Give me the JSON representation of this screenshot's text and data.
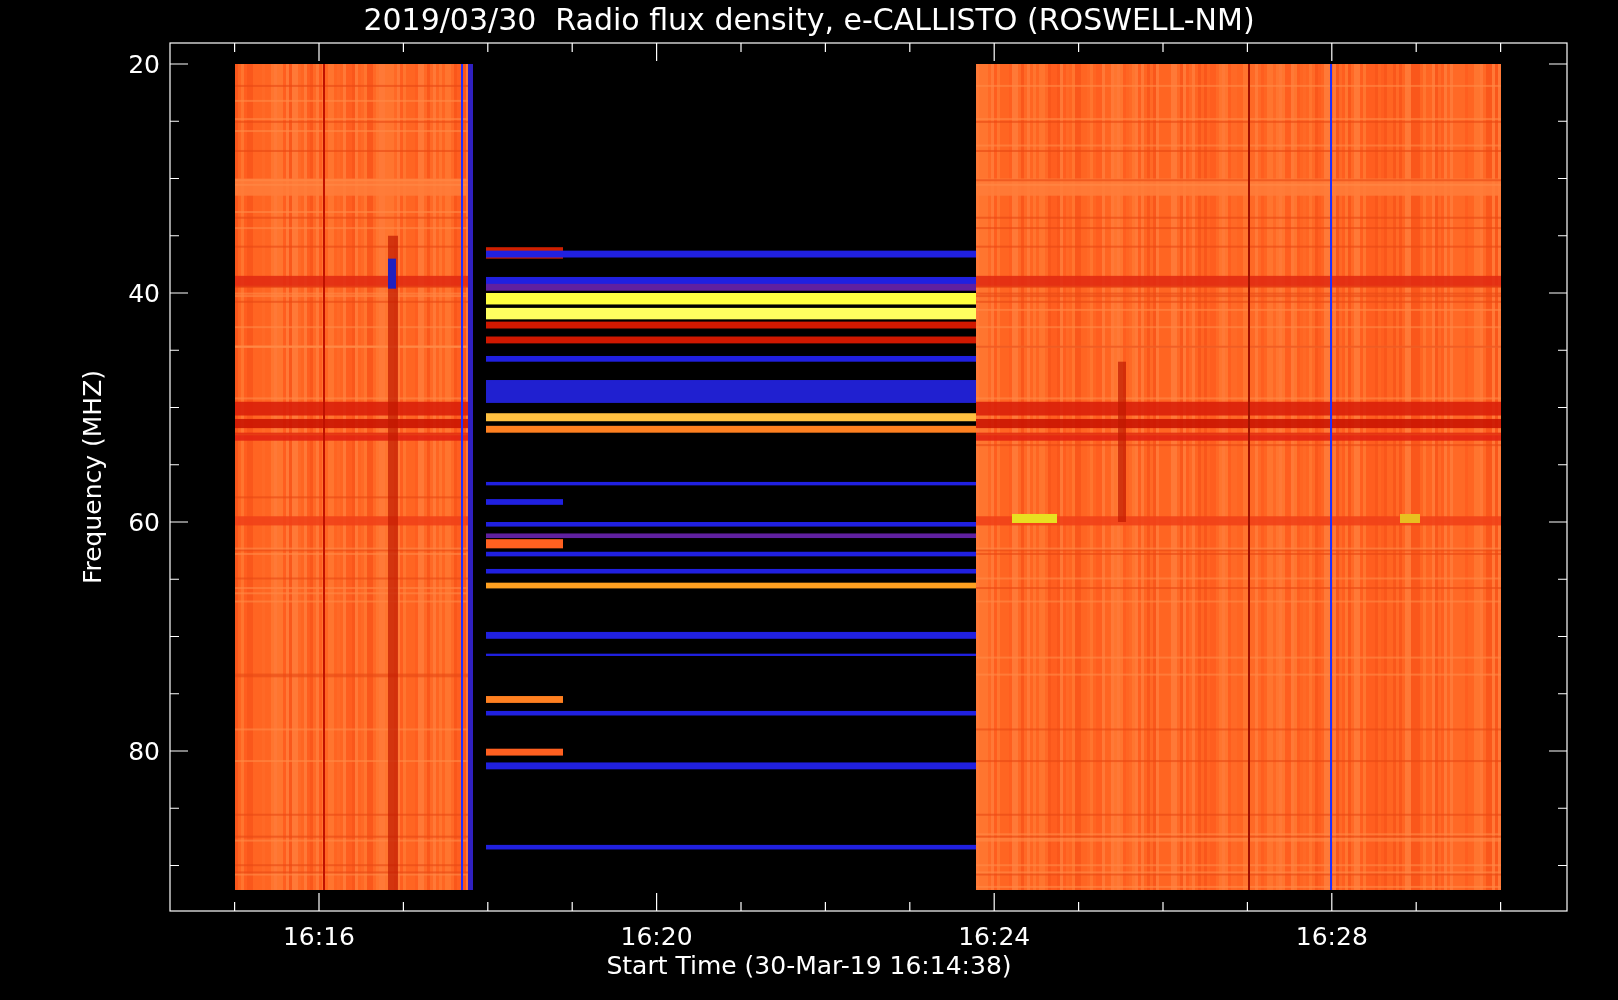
{
  "title": "2019/03/30  Radio flux density, e-CALLISTO (ROSWELL-NM)",
  "y_axis": {
    "label": "Frequency (MHZ)",
    "ticks": [
      "20",
      "40",
      "60",
      "80"
    ]
  },
  "x_axis": {
    "label": "Start Time (30-Mar-19 16:14:38)",
    "ticks": [
      "16:16",
      "16:20",
      "16:24",
      "16:28"
    ]
  }
}
